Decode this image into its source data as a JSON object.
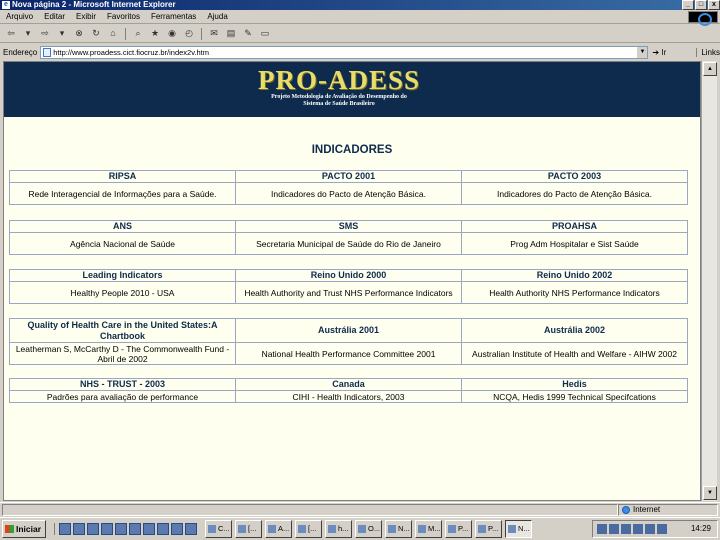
{
  "window": {
    "title": "Nova página 2 - Microsoft Internet Explorer",
    "buttons": [
      "_",
      "□",
      "x"
    ]
  },
  "menu": [
    "Arquivo",
    "Editar",
    "Exibir",
    "Favoritos",
    "Ferramentas",
    "Ajuda"
  ],
  "toolbar_icons": [
    "back-icon",
    "forward-icon",
    "stop-icon",
    "refresh-icon",
    "home-icon",
    "search-icon",
    "favorites-icon",
    "history-icon",
    "mail-icon",
    "print-icon",
    "edit-icon"
  ],
  "address": {
    "label": "Endereço",
    "url": "http://www.proadess.cict.fiocruz.br/index2v.htm",
    "go": "Ir",
    "links": "Links"
  },
  "banner": {
    "title": "PRO-ADESS",
    "subtitle_line1": "Projeto Metodologia de Avaliação do Desempenho do",
    "subtitle_line2": "Sistema de Saúde Brasileiro"
  },
  "heading": "INDICADORES",
  "groups": [
    {
      "headers": [
        "RIPSA",
        "PACTO 2001",
        "PACTO 2003"
      ],
      "cells": [
        "Rede Interagencial de Informações para a Saúde.",
        "Indicadores do Pacto de Atenção Básica.",
        "Indicadores do Pacto de Atenção Básica."
      ]
    },
    {
      "headers": [
        "ANS",
        "SMS",
        "PROAHSA"
      ],
      "cells": [
        "Agência Nacional de Saúde",
        "Secretaria Municipal de Saúde do Rio de Janeiro",
        "Prog Adm Hospitalar e Sist Saúde"
      ]
    },
    {
      "headers": [
        "Leading Indicators",
        "Reino Unido 2000",
        "Reino Unido 2002"
      ],
      "cells": [
        "Healthy People 2010 - USA",
        "Health Authority and Trust NHS Performance Indicators",
        "Health Authority NHS Performance Indicators"
      ]
    },
    {
      "headers": [
        "Quality of Health Care in the United States:A Chartbook",
        "Austrália 2001",
        "Austrália 2002"
      ],
      "cells": [
        "Leatherman S, McCarthy D - The Commonwealth Fund - Abril de 2002",
        "National Health Performance Committee 2001",
        "Australian Institute of Health and Welfare - AIHW 2002"
      ]
    },
    {
      "headers": [
        "NHS - TRUST - 2003",
        "Canada",
        "Hedis"
      ],
      "cells": [
        "Padrões para avaliação de performance",
        "CIHI - Health Indicators, 2003",
        "NCQA, Hedis 1999 Technical Specifcations"
      ]
    }
  ],
  "status": {
    "zone": "Internet"
  },
  "taskbar": {
    "start": "Iniciar",
    "tasks": [
      "C...",
      "[...",
      "A...",
      "[...",
      "h...",
      "O...",
      "N...",
      "M...",
      "P...",
      "P...",
      "N..."
    ],
    "clock": "14:29"
  }
}
